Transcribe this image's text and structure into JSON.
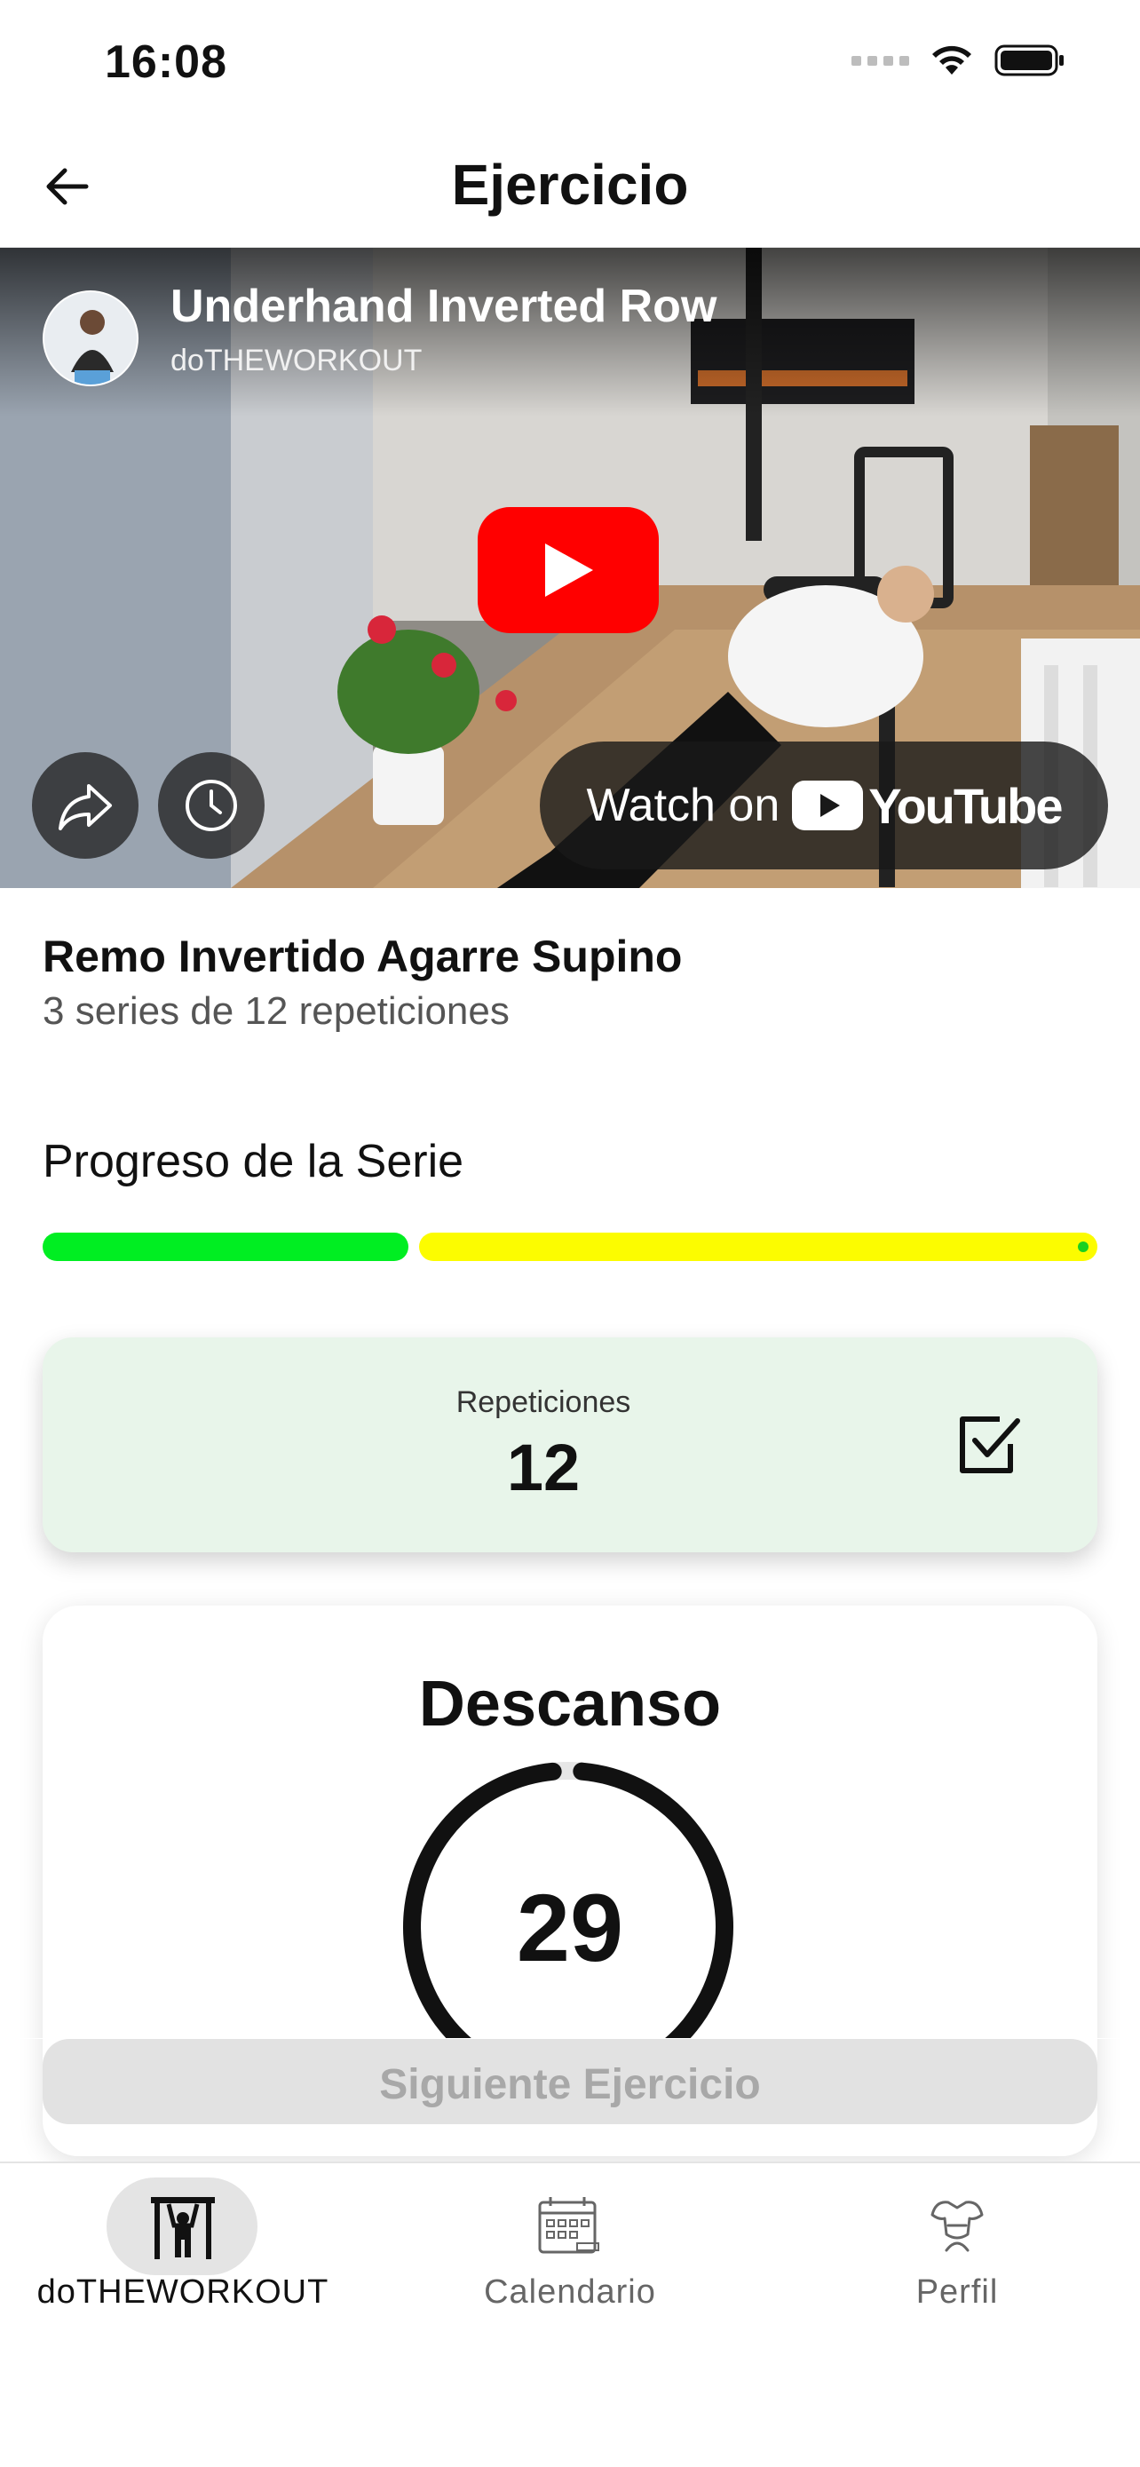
{
  "status_bar": {
    "time": "16:08"
  },
  "header": {
    "title": "Ejercicio"
  },
  "video": {
    "title": "Underhand Inverted Row",
    "channel": "doTHEWORKOUT",
    "watch_on_label": "Watch on",
    "youtube_label": "YouTube"
  },
  "exercise": {
    "name": "Remo Invertido Agarre Supino",
    "detail": "3 series de 12 repeticiones"
  },
  "progress": {
    "label": "Progreso de la Serie",
    "completed_fraction": 0.35,
    "colors": {
      "done": "#00ee22",
      "remaining": "#fcfc00"
    }
  },
  "reps_card": {
    "label": "Repeticiones",
    "value": "12",
    "checked": true
  },
  "rest_card": {
    "title": "Descanso",
    "seconds": "29",
    "ring_fraction": 0.97
  },
  "next_button": {
    "label": "Siguiente Ejercicio"
  },
  "tab_bar": {
    "items": [
      {
        "label": "doTHEWORKOUT",
        "icon": "pullup-bar-icon",
        "active": true
      },
      {
        "label": "Calendario",
        "icon": "calendar-icon",
        "active": false
      },
      {
        "label": "Perfil",
        "icon": "profile-muscle-icon",
        "active": false
      }
    ]
  }
}
